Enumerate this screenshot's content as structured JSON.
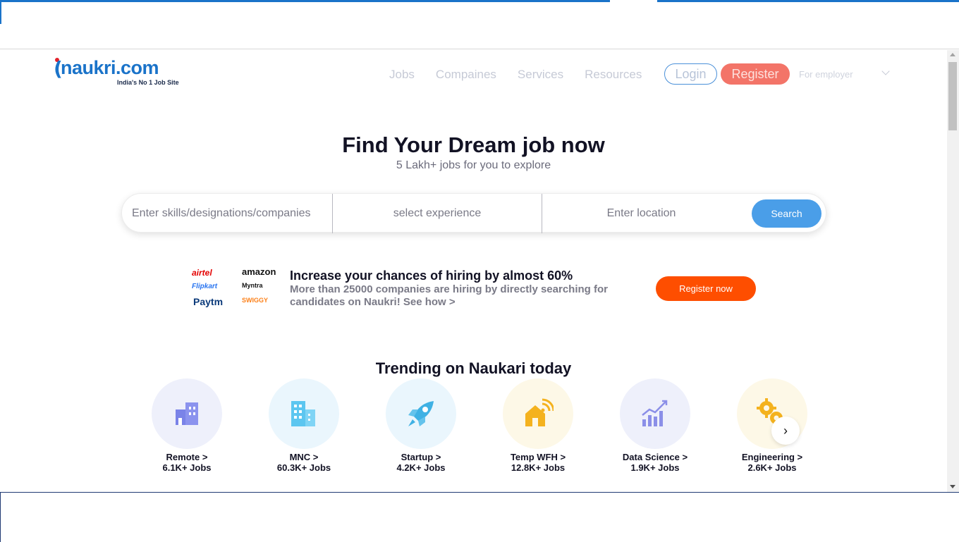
{
  "logo": {
    "name": "naukri.com",
    "tagline": "India's No 1 Job Site"
  },
  "nav": {
    "links": [
      "Jobs",
      "Compaines",
      "Services",
      "Resources"
    ],
    "login": "Login",
    "register": "Register",
    "employer": "For employer"
  },
  "hero": {
    "title": "Find Your Dream job now",
    "subtitle": "5 Lakh+ jobs for you to explore"
  },
  "search": {
    "skills_placeholder": "Enter skills/designations/companies",
    "experience_placeholder": "select experience",
    "location_placeholder": "Enter location",
    "button": "Search"
  },
  "promo": {
    "brands": [
      "airtel",
      "amazon",
      "Flipkart",
      "Myntra",
      "Paytm",
      "SWIGGY"
    ],
    "title": "Increase your chances of hiring by almost 60%",
    "description": "More than 25000 companies are hiring by directly searching for candidates on Naukri! See how >",
    "button": "Register now"
  },
  "trending": {
    "title": "Trending on Naukari today",
    "items": [
      {
        "label": "Remote >",
        "jobs": "6.1K+ Jobs",
        "icon": "building-icon",
        "bg": "#eef0fb",
        "color": "#7a83e8"
      },
      {
        "label": "MNC >",
        "jobs": "60.3K+ Jobs",
        "icon": "office-tower-icon",
        "bg": "#eaf6fd",
        "color": "#5cc6f0"
      },
      {
        "label": "Startup >",
        "jobs": "4.2K+ Jobs",
        "icon": "rocket-icon",
        "bg": "#eaf6fd",
        "color": "#3fb1e4"
      },
      {
        "label": "Temp WFH >",
        "jobs": "12.8K+ Jobs",
        "icon": "home-wifi-icon",
        "bg": "#fdf8e7",
        "color": "#f4b21e"
      },
      {
        "label": "Data Science >",
        "jobs": "1.9K+ Jobs",
        "icon": "chart-icon",
        "bg": "#eef0fb",
        "color": "#8b8fe8"
      },
      {
        "label": "Engineering >",
        "jobs": "2.6K+ Jobs",
        "icon": "gears-icon",
        "bg": "#fdf8e7",
        "color": "#f4b21e"
      }
    ]
  }
}
